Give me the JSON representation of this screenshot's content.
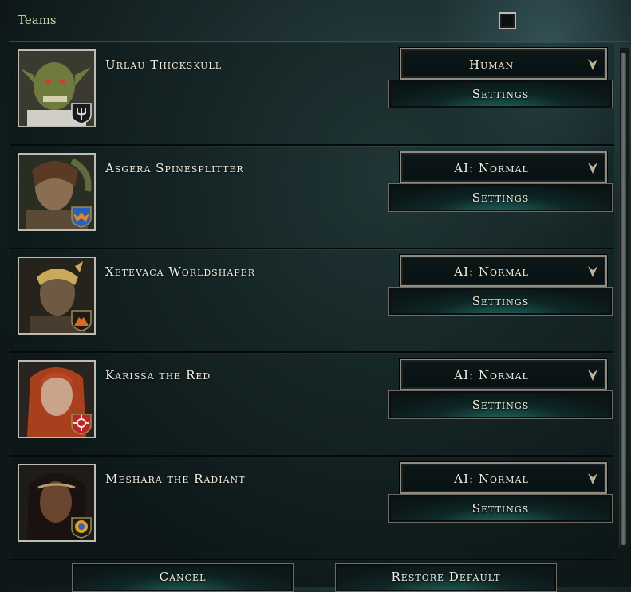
{
  "header": {
    "teams_label": "Teams",
    "teams_checked": false
  },
  "players": [
    {
      "name": "Urlau Thickskull",
      "controller": "Human",
      "settings_label": "Settings",
      "faction_icon": "trident-icon",
      "faction_color": "#d9d9d9",
      "portrait_icon": "goblin-portrait"
    },
    {
      "name": "Asgera Spinesplitter",
      "controller": "AI: Normal",
      "settings_label": "Settings",
      "faction_icon": "bat-wing-icon",
      "faction_color": "#2e5fb8",
      "portrait_icon": "orc-woman-portrait"
    },
    {
      "name": "Xetevaca Worldshaper",
      "controller": "AI: Normal",
      "settings_label": "Settings",
      "faction_icon": "volcano-icon",
      "faction_color": "#e06a1a",
      "portrait_icon": "horned-woman-portrait"
    },
    {
      "name": "Karissa the Red",
      "controller": "AI: Normal",
      "settings_label": "Settings",
      "faction_icon": "compass-star-icon",
      "faction_color": "#b8262a",
      "portrait_icon": "red-haired-woman-portrait"
    },
    {
      "name": "Meshara the Radiant",
      "controller": "AI: Normal",
      "settings_label": "Settings",
      "faction_icon": "sun-icon",
      "faction_color": "#3a62b8",
      "portrait_icon": "dark-haired-woman-portrait"
    }
  ],
  "footer": {
    "cancel_label": "Cancel",
    "restore_label": "Restore Default"
  }
}
